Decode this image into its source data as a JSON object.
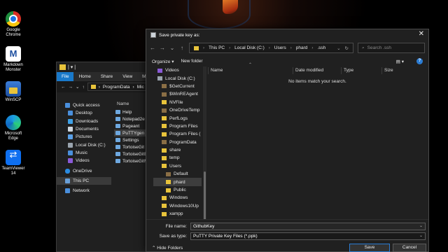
{
  "desktop_icons": [
    {
      "line1": "Google",
      "line2": "Chrome"
    },
    {
      "line1": "Markdown",
      "line2": "Monster"
    },
    {
      "line1": "WinSCP",
      "line2": ""
    },
    {
      "line1": "Microsoft",
      "line2": "Edge"
    },
    {
      "line1": "TeamViewer",
      "line2": "14"
    }
  ],
  "explorer": {
    "title_suffix": "| ▾ |",
    "ribbon": [
      "File",
      "Home",
      "Share",
      "View",
      "Ma"
    ],
    "breadcrumb": [
      "ProgramData",
      "Mic"
    ],
    "column_name": "Name",
    "nav": [
      {
        "label": "Quick access"
      },
      {
        "label": "Desktop"
      },
      {
        "label": "Downloads"
      },
      {
        "label": "Documents"
      },
      {
        "label": "Pictures"
      },
      {
        "label": "Local Disk (C:)"
      },
      {
        "label": "Music"
      },
      {
        "label": "Videos"
      },
      {
        "label": "OneDrive"
      },
      {
        "label": "This PC"
      },
      {
        "label": "Network"
      }
    ],
    "files": [
      {
        "label": "Help"
      },
      {
        "label": "Notepad2e"
      },
      {
        "label": "Pageant"
      },
      {
        "label": "PuTTYgen"
      },
      {
        "label": "Settings"
      },
      {
        "label": "TortoiseGit"
      },
      {
        "label": "TortoiseGitB"
      },
      {
        "label": "TortoiseGitM"
      }
    ]
  },
  "dialog": {
    "title": "Save private key as:",
    "close": "✕",
    "path": [
      "This PC",
      "Local Disk (C:)",
      "Users",
      "phard",
      ".ssh"
    ],
    "search_placeholder": "Search .ssh",
    "organize": "Organize",
    "new_folder": "New folder",
    "help": "?",
    "tree": [
      {
        "label": "Videos"
      },
      {
        "label": "Local Disk (C:)"
      },
      {
        "label": "$GetCurrent"
      },
      {
        "label": "$WinREAgent"
      },
      {
        "label": "NVFile"
      },
      {
        "label": "OneDriveTemp"
      },
      {
        "label": "PerfLogs"
      },
      {
        "label": "Program Files"
      },
      {
        "label": "Program Files ("
      },
      {
        "label": "ProgramData"
      },
      {
        "label": "share"
      },
      {
        "label": "temp"
      },
      {
        "label": "Users"
      },
      {
        "label": "Default"
      },
      {
        "label": "phard"
      },
      {
        "label": "Public"
      },
      {
        "label": "Windows"
      },
      {
        "label": "Windows10Up"
      },
      {
        "label": "xampp"
      }
    ],
    "columns": [
      "Name",
      "Date modified",
      "Type",
      "Size"
    ],
    "empty_message": "No items match your search.",
    "file_name_label": "File name:",
    "file_name_value": "GithubKey",
    "save_type_label": "Save as type:",
    "save_type_value": "PuTTY Private Key Files (*.ppk)",
    "hide_folders": "Hide Folders",
    "save_button": "Save",
    "cancel_button": "Cancel"
  }
}
